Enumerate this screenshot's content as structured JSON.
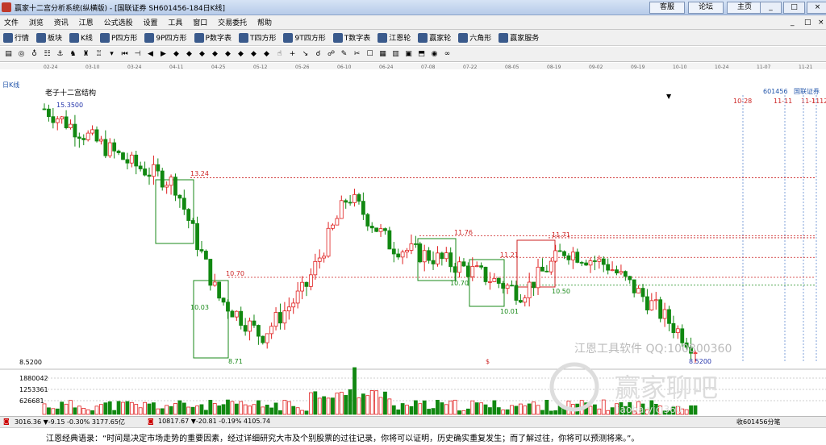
{
  "window": {
    "title": "赢家十二宫分析系统(纵横版) - [国联证券  SH601456-184日K线]",
    "links": [
      "客服",
      "论坛",
      "主页"
    ],
    "win_buttons": [
      "_",
      "□",
      "×"
    ],
    "mdi_buttons": [
      "_",
      "□",
      "×"
    ]
  },
  "menu": [
    "文件",
    "浏览",
    "资讯",
    "江恩",
    "公式选股",
    "设置",
    "工具",
    "窗口",
    "交易委托",
    "帮助"
  ],
  "toolbar1": [
    "行情",
    "板块",
    "K线",
    "P四方形",
    "9P四方形",
    "P数字表",
    "T四方形",
    "9T四方形",
    "T数字表",
    "江恩轮",
    "赢家轮",
    "六角形",
    "赢家服务"
  ],
  "toolbar2_icons": [
    "▤",
    "◎",
    "♁",
    "☷",
    "⚓",
    "♞",
    "♜",
    "♖",
    "▾",
    "⏮",
    "⊣",
    "◀",
    "▶",
    "◆",
    "◆",
    "◆",
    "◆",
    "◆",
    "◆",
    "◆",
    "◆",
    "☝",
    "+",
    "↘",
    "☌",
    "☍",
    "✎",
    "✂",
    "☐",
    "▦",
    "▥",
    "▣",
    "⬒",
    "◉",
    "∞"
  ],
  "chart": {
    "period_label": "日K线",
    "structure_label": "老子十二宫结构",
    "stock_code": "601456",
    "stock_name": "国联证券",
    "watermark_text": "江恩工具软件 QQ:100800360",
    "watermark_logo": "赢家聊吧",
    "watermark_url": "liaoba.yjcj360",
    "s_marker": "$",
    "date_ticks": [
      "02-24",
      "03-10",
      "03-24",
      "04-11",
      "04-25",
      "05-12",
      "05-26",
      "06-10",
      "06-24",
      "07-08",
      "07-22",
      "08-05",
      "08-19",
      "09-02",
      "09-19",
      "10-10",
      "10-24",
      "11-07",
      "11-21"
    ],
    "date_markers": [
      "10-28",
      "11-11",
      "11-1",
      "1112"
    ],
    "price_labels": {
      "high": "15.3500",
      "low": "8.5200",
      "axis_low": "8.5200"
    },
    "levels": [
      {
        "text": "13.24",
        "color": "#cc2222"
      },
      {
        "text": "10.70",
        "color": "#cc2222"
      },
      {
        "text": "10.03",
        "color": "#1a8a1a"
      },
      {
        "text": "8.71",
        "color": "#1a8a1a"
      },
      {
        "text": "11.76",
        "color": "#cc2222"
      },
      {
        "text": "11.21",
        "color": "#cc2222"
      },
      {
        "text": "11.71",
        "color": "#cc2222"
      },
      {
        "text": "10.70",
        "color": "#1a8a1a"
      },
      {
        "text": "10.01",
        "color": "#1a8a1a"
      },
      {
        "text": "10.50",
        "color": "#1a8a1a"
      }
    ],
    "volume_axis": [
      "1880042",
      "1253361",
      "626681"
    ],
    "colors": {
      "up": "#e02020",
      "down": "#118811",
      "ma": "#0000cc",
      "grid": "#cfcfcf"
    }
  },
  "chart_data": {
    "type": "bar",
    "title": "SH601456 日K线",
    "categories": [
      "02-24",
      "03-10",
      "03-24",
      "04-11",
      "04-25",
      "05-12",
      "05-26",
      "06-10",
      "06-24",
      "07-08",
      "07-22",
      "08-05",
      "08-19",
      "09-02",
      "09-19",
      "10-10"
    ],
    "series": [
      {
        "name": "close",
        "values": [
          15.0,
          14.3,
          13.6,
          13.1,
          10.2,
          9.2,
          10.4,
          12.8,
          11.5,
          11.2,
          10.8,
          10.3,
          11.4,
          11.0,
          10.0,
          8.9
        ]
      }
    ],
    "ylim": [
      8.52,
      15.35
    ]
  },
  "statusbar": {
    "sh_index": "3016.36 ▼-9.15 -0.30% 3177.65亿",
    "sz_index": "10817.67 ▼-20.81 -0.19% 4105.74",
    "right_text": "收601456分笔"
  },
  "quote": "江恩经典语录：“时间是决定市场走势的重要因素，经过详细研究大市及个别股票的过往记录，你将可以证明，历史确实重复发生；而了解过往，你将可以预测将来。”。"
}
